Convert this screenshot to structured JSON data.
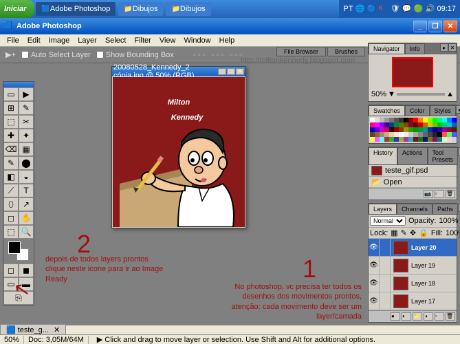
{
  "taskbar": {
    "start": "Iniciar",
    "items": [
      "Adobe Photoshop",
      "Dibujos",
      "Dibujos"
    ],
    "lang": "PT",
    "time": "09:17"
  },
  "titlebar": {
    "title": "Adobe Photoshop"
  },
  "menu": [
    "File",
    "Edit",
    "Image",
    "Layer",
    "Select",
    "Filter",
    "View",
    "Window",
    "Help"
  ],
  "optbar": {
    "autoSelect": "Auto Select Layer",
    "bounding": "Show Bounding Box"
  },
  "paletteTabsTop": [
    "File Browser",
    "Brushes"
  ],
  "watermark": "http://miltonkennedy.blogspot.com",
  "doc": {
    "title": "20080528_Kennedy_2 cópia.jpg @ 50% (RGB)"
  },
  "toolbox": {
    "tools": [
      "▭",
      "▶",
      "⊞",
      "✎",
      "⬚",
      "✂",
      "✚",
      "✦",
      "⌫",
      "▦",
      "✎",
      "⬤",
      "◧",
      "◒",
      "⟋",
      "T",
      "⬯",
      "↗",
      "◻",
      "✋",
      "⬚",
      "🔍"
    ]
  },
  "panels": {
    "navigator": {
      "tabs": [
        "Navigator",
        "Info"
      ],
      "zoom": "50%"
    },
    "swatches": {
      "tabs": [
        "Swatches",
        "Color",
        "Styles"
      ]
    },
    "history": {
      "tabs": [
        "History",
        "Actions",
        "Tool Presets"
      ],
      "file": "teste_gif.psd",
      "state": "Open"
    },
    "layers": {
      "tabs": [
        "Layers",
        "Channels",
        "Paths"
      ],
      "blend": "Normal",
      "opacityLabel": "Opacity:",
      "opacity": "100%",
      "lockLabel": "Lock:",
      "fillLabel": "Fill:",
      "fill": "100%",
      "items": [
        "Layer 20",
        "Layer 19",
        "Layer 18",
        "Layer 17"
      ]
    }
  },
  "annotations": {
    "num1": "1",
    "text1": "No photoshop, vc precisa ter todos os desenhos dos movimentos prontos, atenção: cada movimento deve ser um layer/camada",
    "num2": "2",
    "text2": "depois de todos layers prontos clique neste icone para ir ao Image Ready"
  },
  "status": {
    "tabFile": "teste_g...",
    "zoom": "50%",
    "doc": "Doc: 3,05M/64M",
    "hint": "Click and drag to move layer or selection. Use Shift and Alt for additional options."
  },
  "swatchColors": [
    "#fff",
    "#ddd",
    "#bbb",
    "#999",
    "#777",
    "#555",
    "#333",
    "#000",
    "#800",
    "#f00",
    "#f80",
    "#ff0",
    "#8f0",
    "#0f0",
    "#0f8",
    "#0ff",
    "#08f",
    "#00f",
    "#f08",
    "#f0f",
    "#80f",
    "#408",
    "#048",
    "#084",
    "#480",
    "#840",
    "#804",
    "#600",
    "#c00",
    "#c60",
    "#cc0",
    "#6c0",
    "#0c0",
    "#0c6",
    "#0cc",
    "#06c",
    "#00c",
    "#60c",
    "#c0c",
    "#c06",
    "#300",
    "#900",
    "#930",
    "#990",
    "#390",
    "#090",
    "#093",
    "#099",
    "#039",
    "#009",
    "#309",
    "#909",
    "#903",
    "#420",
    "#642",
    "#864",
    "#a86",
    "#ca8",
    "#eca",
    "#fec",
    "#fff",
    "#eee",
    "#ccc",
    "#aaa",
    "#888",
    "#666",
    "#444",
    "#222",
    "#000",
    "#f55",
    "#5f5",
    "#55f",
    "#ff5",
    "#f5f",
    "#5ff",
    "#a33",
    "#3a3",
    "#33a",
    "#aa3",
    "#a3a",
    "#3aa",
    "#711",
    "#171",
    "#117",
    "#771",
    "#717",
    "#177",
    "#cfc",
    "#fcc",
    "#ccf"
  ]
}
